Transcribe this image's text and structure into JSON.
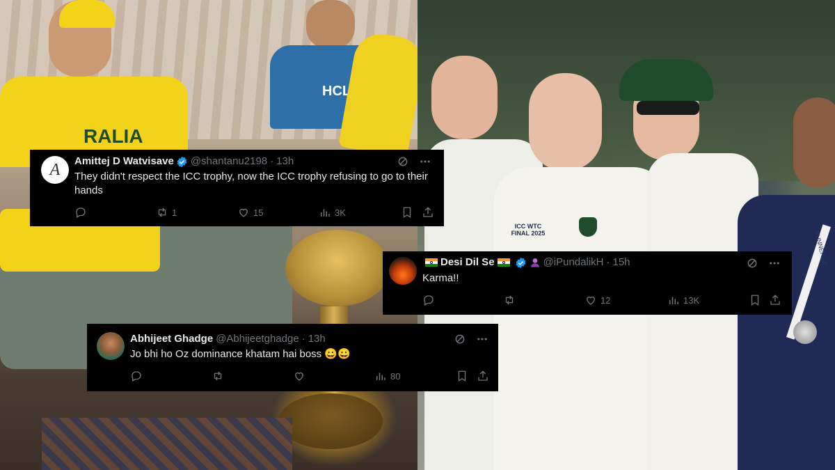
{
  "tweets": [
    {
      "display_name": "Amittej D Watvisave",
      "handle": "@shantanu2198",
      "time": "13h",
      "text": "They didn't respect the ICC trophy, now the ICC trophy refusing to go to their hands",
      "counts": {
        "replies": "",
        "reposts": "1",
        "likes": "15",
        "views": "3K"
      },
      "avatar_letter": "A",
      "verified": true
    },
    {
      "display_name": "Desi Dil Se",
      "handle": "@iPundalikH",
      "time": "15h",
      "text": "Karma!!",
      "counts": {
        "replies": "",
        "reposts": "",
        "likes": "12",
        "views": "13K"
      },
      "verified": true
    },
    {
      "display_name": "Abhijeet Ghadge",
      "handle": "@Abhijeetghadge",
      "time": "13h",
      "text": "Jo bhi ho Oz dominance khatam hai boss 😀😀",
      "counts": {
        "replies": "",
        "reposts": "",
        "likes": "",
        "views": "80"
      },
      "verified": false
    }
  ],
  "photo_text": {
    "shirt_left": "RALIA",
    "shirt_right": "HCLTech",
    "badge_right": "ICC WTC FINAL 2025",
    "strap_right": "RUNNER-UP"
  },
  "colors": {
    "tweet_bg": "#000000",
    "text": "#e7e9ea",
    "muted": "#71767b",
    "verified": "#1d9bf0",
    "aus_yellow": "#f3d21a",
    "aus_green": "#1f4d2b"
  },
  "icons": [
    "reply-icon",
    "repost-icon",
    "like-icon",
    "views-icon",
    "bookmark-icon",
    "share-icon",
    "grok-icon",
    "more-icon",
    "verified-badge-icon"
  ]
}
